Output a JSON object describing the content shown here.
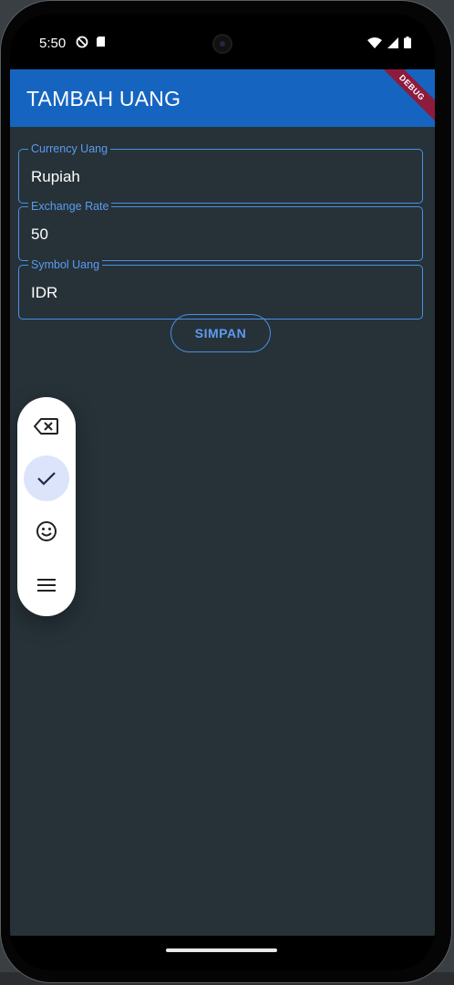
{
  "status_bar": {
    "time": "5:50"
  },
  "app_bar": {
    "title": "TAMBAH UANG",
    "debug_banner": "DEBUG",
    "color": "#1565c0"
  },
  "form": {
    "fields": [
      {
        "label": "Currency Uang",
        "value": "Rupiah"
      },
      {
        "label": "Exchange Rate",
        "value": "50"
      },
      {
        "label": "Symbol Uang",
        "value": "IDR"
      }
    ],
    "save_label": "SIMPAN"
  },
  "floating_keyboard_toolbar": {
    "buttons": [
      {
        "icon": "backspace-icon"
      },
      {
        "icon": "check-icon",
        "active": true
      },
      {
        "icon": "emoji-icon"
      },
      {
        "icon": "menu-icon"
      }
    ]
  },
  "colors": {
    "background": "#263238",
    "accent": "#4a90e2"
  }
}
